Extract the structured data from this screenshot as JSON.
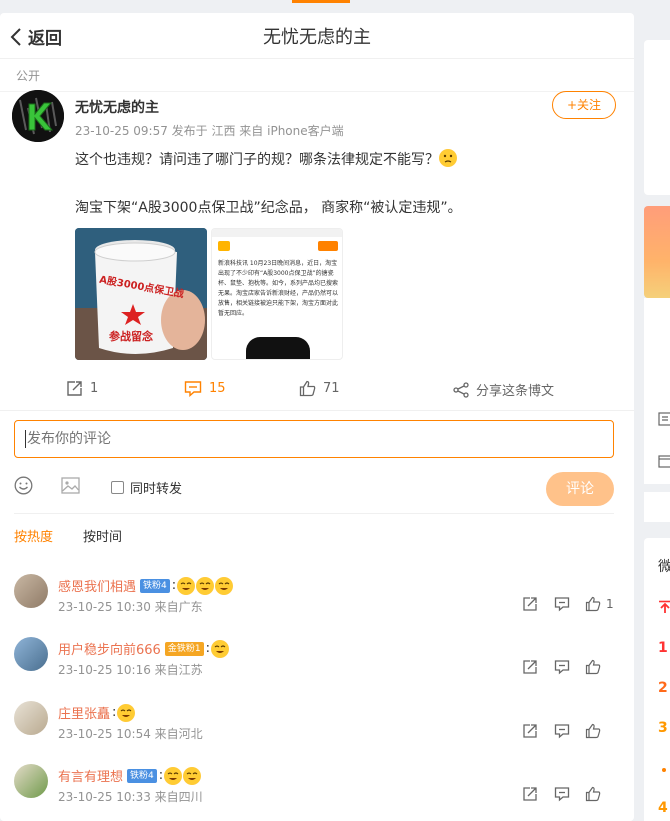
{
  "header": {
    "back_label": "返回",
    "title": "无忧无虑的主"
  },
  "post": {
    "visibility": "公开",
    "author": "无忧无虑的主",
    "meta": "23-10-25 09:57  发布于 江西  来自 iPhone客户端",
    "follow_label": "+关注",
    "text_line1": "这个也违规？请问违了哪门子的规？哪条法律规定不能写？",
    "text_line2": "淘宝下架“A股3000点保卫战”纪念品， 商家称“被认定违规”。",
    "image1_text_a": "A股3000点保卫战",
    "image1_text_b": "参战留念",
    "image2_headline": "新浪科技讯 10月23日晚间消息，近日，淘宝出现了不少印有“A股3000点保卫战”的搪瓷杯、鼠垫、抱枕等。如今，系列产品均已搜索无果。淘宝店家告诉新浪财经，产品仍然可以放售，相关链接被迫只能下架，淘宝方面对此暂无回应。",
    "repost_count": "1",
    "comment_count": "15",
    "like_count": "71",
    "share_label": "分享这条博文"
  },
  "composer": {
    "placeholder": "发布你的评论",
    "repost_label": "同时转发",
    "submit_label": "评论"
  },
  "sort": {
    "hot": "按热度",
    "time": "按时间"
  },
  "comments": [
    {
      "name": "感恩我们相遇",
      "badge": "铁粉4",
      "badge_color": "#4a90e2",
      "meta": "23-10-25 10:30 来自广东",
      "like_count": "1",
      "emojis": 3
    },
    {
      "name": "用户稳步向前666",
      "badge": "金铁粉1",
      "badge_color": "#f5a623",
      "meta": "23-10-25 10:16 来自江苏",
      "like_count": "",
      "emojis": 1
    },
    {
      "name": "庄里张矗",
      "badge": "",
      "badge_color": "",
      "meta": "23-10-25 10:54 来自河北",
      "like_count": "",
      "emojis": 1
    },
    {
      "name": "有言有理想",
      "badge": "铁粉4",
      "badge_color": "#4a90e2",
      "meta": "23-10-25 10:33 来自四川",
      "like_count": "",
      "emojis": 2
    }
  ],
  "sidebar": {
    "heading_char": "微",
    "rank1": "1",
    "rank2": "2",
    "rank3": "3",
    "rank4": "4"
  },
  "colors": {
    "accent": "#ff8200",
    "name": "#eb7350"
  }
}
